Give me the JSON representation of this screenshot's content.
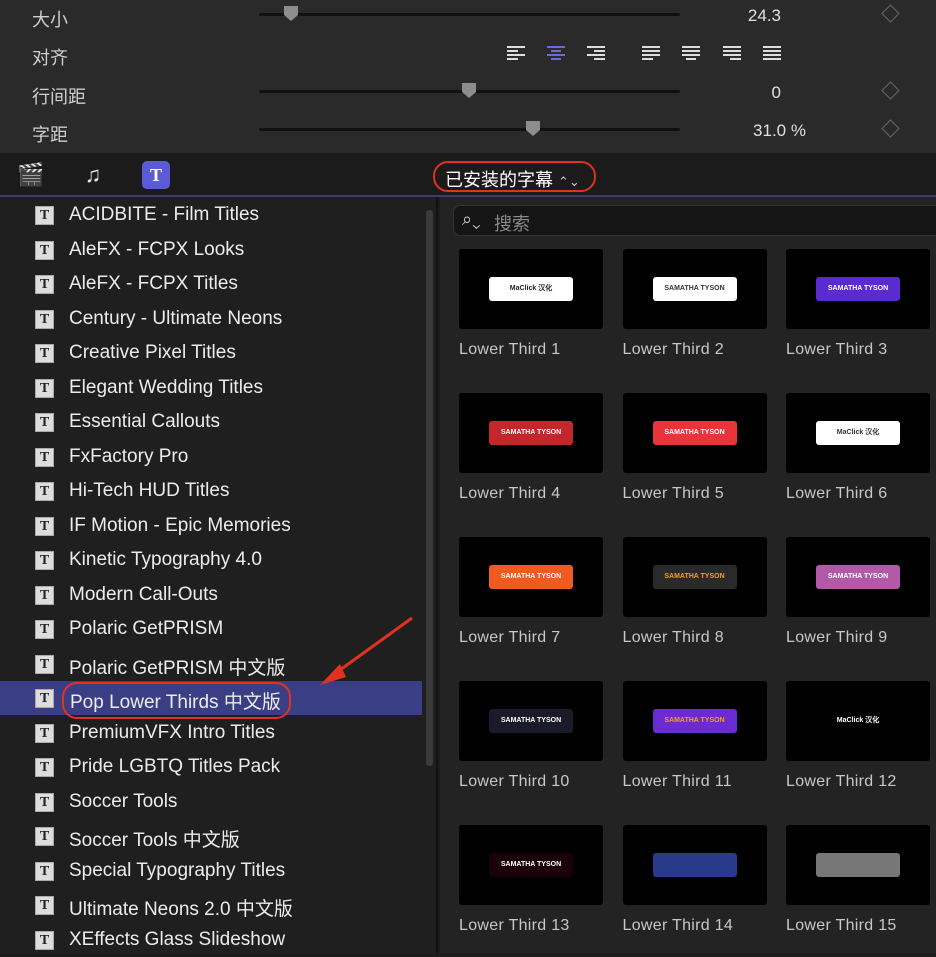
{
  "inspector": {
    "size": {
      "label": "大小",
      "value": "24.3",
      "slider": 0.07
    },
    "align": {
      "label": "对齐",
      "options": [
        "align-left",
        "align-center",
        "align-right",
        "justify-left",
        "justify-center",
        "justify-right",
        "justify-full"
      ],
      "selected": 1
    },
    "line_spacing": {
      "label": "行间距",
      "value": "0",
      "slider": 0.5
    },
    "tracking": {
      "label": "字距",
      "value": "31.0",
      "unit": "%",
      "slider": 0.65
    }
  },
  "toolbar": {
    "icons": [
      "clapper-star-icon",
      "music-photo-icon",
      "titles-icon"
    ],
    "active": 2,
    "picker_label": "已安装的字幕",
    "picker_arrow": "⌃⌄"
  },
  "sidebar": {
    "selected": 14,
    "items": [
      "ACIDBITE - Film Titles",
      "AleFX - FCPX Looks",
      "AleFX - FCPX Titles",
      "Century - Ultimate Neons",
      "Creative Pixel Titles",
      "Elegant Wedding Titles",
      "Essential Callouts",
      "FxFactory Pro",
      "Hi-Tech HUD Titles",
      "IF Motion - Epic Memories",
      "Kinetic Typography 4.0",
      "Modern Call-Outs",
      "Polaric GetPRISM",
      "Polaric GetPRISM 中文版",
      "Pop Lower Thirds 中文版",
      "PremiumVFX Intro Titles",
      "Pride LGBTQ Titles Pack",
      "Soccer Tools",
      "Soccer Tools 中文版",
      "Special Typography Titles",
      "Ultimate Neons 2.0 中文版",
      "XEffects Glass Slideshow"
    ]
  },
  "search": {
    "placeholder": "搜索"
  },
  "browser": {
    "items": [
      {
        "name": "Lower Third 1",
        "thumb": "MaClick 汉化",
        "bg": "#ffffff",
        "fg": "#222"
      },
      {
        "name": "Lower Third 2",
        "thumb": "SAMATHA TYSON",
        "bg": "#ffffff",
        "fg": "#333"
      },
      {
        "name": "Lower Third 3",
        "thumb": "SAMATHA TYSON",
        "bg": "#5a2bd0",
        "fg": "#fff"
      },
      {
        "name": "Lower Third 4",
        "thumb": "SAMATHA TYSON",
        "bg": "#c3262b",
        "fg": "#fff"
      },
      {
        "name": "Lower Third 5",
        "thumb": "SAMATHA TYSON",
        "bg": "#e8343a",
        "fg": "#fff"
      },
      {
        "name": "Lower Third 6",
        "thumb": "MaClick 汉化",
        "bg": "#ffffff",
        "fg": "#333"
      },
      {
        "name": "Lower Third 7",
        "thumb": "SAMATHA TYSON",
        "bg": "#f05a1e",
        "fg": "#fff"
      },
      {
        "name": "Lower Third 8",
        "thumb": "SAMATHA TYSON",
        "bg": "#2a2a2a",
        "fg": "#f6a019"
      },
      {
        "name": "Lower Third 9",
        "thumb": "SAMATHA TYSON",
        "bg": "#b25aa8",
        "fg": "#fff"
      },
      {
        "name": "Lower Third 10",
        "thumb": "SAMATHA TYSON",
        "bg": "#1a1a2a",
        "fg": "#fff"
      },
      {
        "name": "Lower Third 11",
        "thumb": "SAMATHA TYSON",
        "bg": "#6a2bd0",
        "fg": "#f6a019"
      },
      {
        "name": "Lower Third 12",
        "thumb": "MaClick 汉化",
        "bg": "#000000",
        "fg": "#fff"
      },
      {
        "name": "Lower Third 13",
        "thumb": "SAMATHA TYSON",
        "bg": "#1a0008",
        "fg": "#fff"
      },
      {
        "name": "Lower Third 14",
        "thumb": "",
        "bg": "#2a3a8a",
        "fg": "#fff"
      },
      {
        "name": "Lower Third 15",
        "thumb": "",
        "bg": "#777777",
        "fg": "#fff"
      }
    ]
  },
  "colors": {
    "accent": "#5b5bd6",
    "selection": "#3a3f85",
    "annotation": "#e0321e"
  }
}
